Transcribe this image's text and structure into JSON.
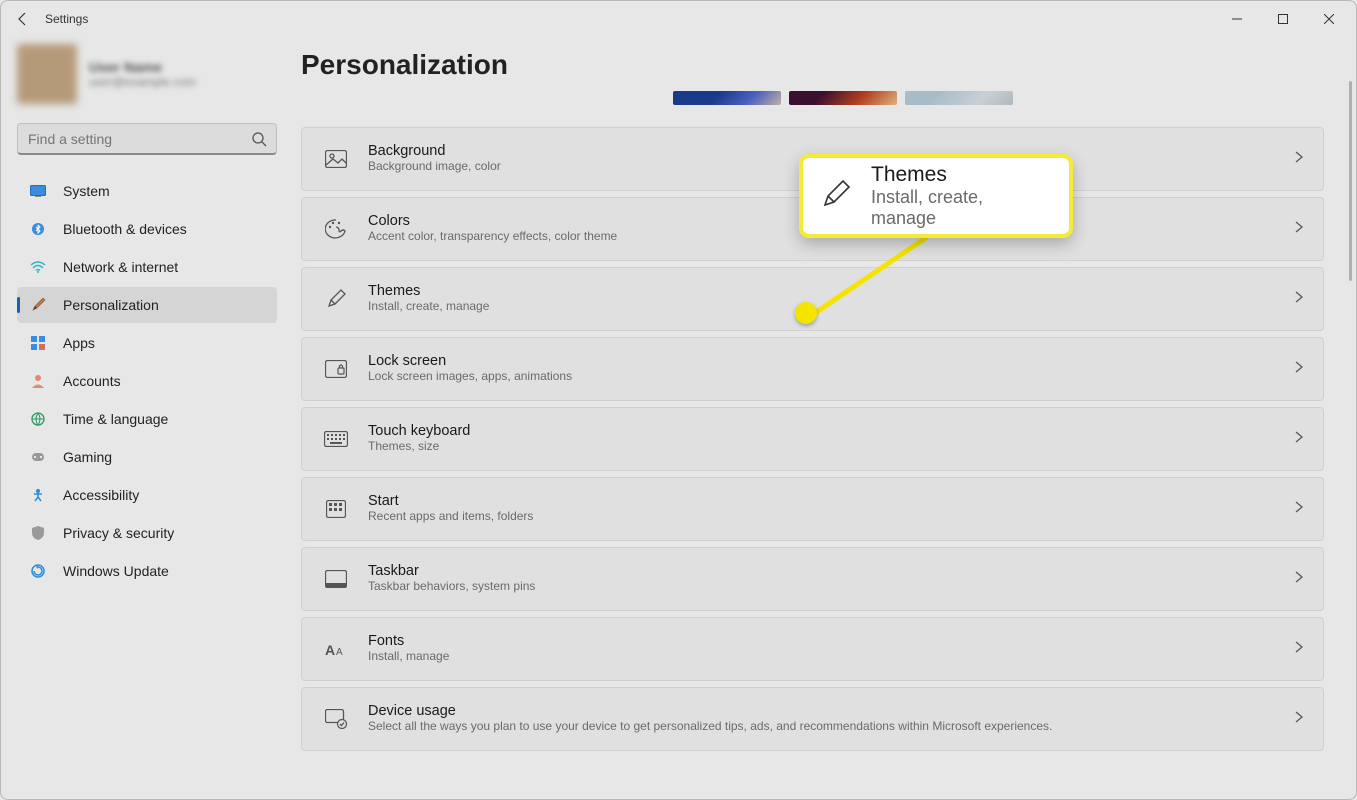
{
  "window": {
    "title": "Settings"
  },
  "account": {
    "name": "User Name",
    "email": "user@example.com"
  },
  "search": {
    "placeholder": "Find a setting"
  },
  "nav": {
    "items": [
      {
        "label": "System",
        "color": "#0078d4"
      },
      {
        "label": "Bluetooth & devices",
        "color": "#0078d4"
      },
      {
        "label": "Network & internet",
        "color": "#0ea5a0"
      },
      {
        "label": "Personalization",
        "color": "#b07040"
      },
      {
        "label": "Apps",
        "color": "#0078d4"
      },
      {
        "label": "Accounts",
        "color": "#d07060"
      },
      {
        "label": "Time & language",
        "color": "#1a7a50"
      },
      {
        "label": "Gaming",
        "color": "#7a7a7a"
      },
      {
        "label": "Accessibility",
        "color": "#1a7ad4"
      },
      {
        "label": "Privacy & security",
        "color": "#7a7a7a"
      },
      {
        "label": "Windows Update",
        "color": "#1a7ad4"
      }
    ],
    "active_index": 3
  },
  "page": {
    "title": "Personalization"
  },
  "cards": [
    {
      "id": "background",
      "title": "Background",
      "sub": "Background image, color"
    },
    {
      "id": "colors",
      "title": "Colors",
      "sub": "Accent color, transparency effects, color theme"
    },
    {
      "id": "themes",
      "title": "Themes",
      "sub": "Install, create, manage"
    },
    {
      "id": "lock-screen",
      "title": "Lock screen",
      "sub": "Lock screen images, apps, animations"
    },
    {
      "id": "touch-keyboard",
      "title": "Touch keyboard",
      "sub": "Themes, size"
    },
    {
      "id": "start",
      "title": "Start",
      "sub": "Recent apps and items, folders"
    },
    {
      "id": "taskbar",
      "title": "Taskbar",
      "sub": "Taskbar behaviors, system pins"
    },
    {
      "id": "fonts",
      "title": "Fonts",
      "sub": "Install, manage"
    },
    {
      "id": "device-usage",
      "title": "Device usage",
      "sub": "Select all the ways you plan to use your device to get personalized tips, ads, and recommendations within Microsoft experiences."
    }
  ],
  "callout": {
    "title": "Themes",
    "sub": "Install, create, manage"
  }
}
